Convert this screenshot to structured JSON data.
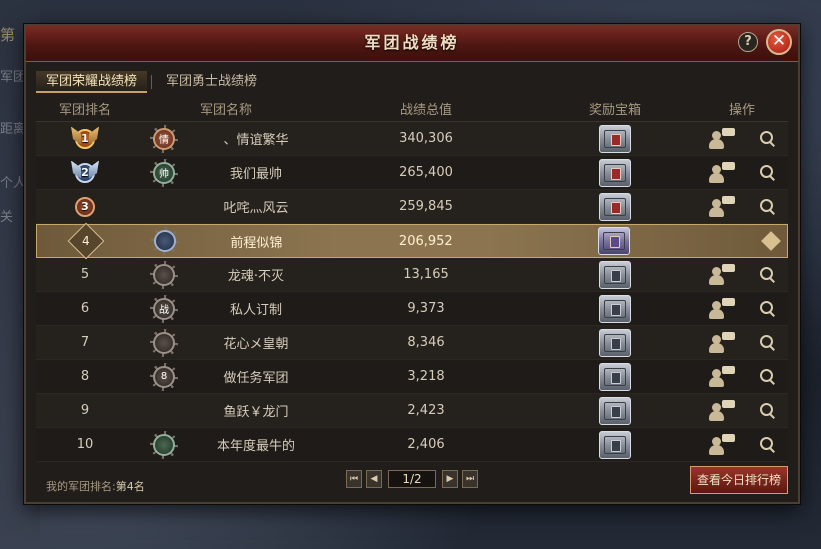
{
  "background": {
    "left_texts": [
      "第",
      "军团",
      "距离",
      "个人",
      "关"
    ]
  },
  "dialog": {
    "title": "军团战绩榜",
    "help_label": "?",
    "close_label": "✕"
  },
  "tabs": [
    {
      "label": "军团荣耀战绩榜",
      "active": true
    },
    {
      "label": "军团勇士战绩榜",
      "active": false
    }
  ],
  "columns": {
    "rank": "军团排名",
    "name": "军团名称",
    "score": "战绩总值",
    "chest": "奖励宝箱",
    "action": "操作"
  },
  "rows": [
    {
      "rank": "1",
      "emblem": "情",
      "name": "、情谊繁华",
      "score": "340,306",
      "medal": "gold",
      "emblem_color": "red",
      "chest": "red"
    },
    {
      "rank": "2",
      "emblem": "帅",
      "name": "我们最帅",
      "score": "265,400",
      "medal": "silver",
      "emblem_color": "green",
      "chest": "red"
    },
    {
      "rank": "3",
      "emblem": "",
      "name": "叱咤灬风云",
      "score": "259,845",
      "medal": "bronze",
      "emblem_color": "empty",
      "chest": "red"
    },
    {
      "rank": "4",
      "emblem": "",
      "name": "前程似锦",
      "score": "206,952",
      "medal": "self",
      "emblem_color": "blue",
      "chest": "purple"
    },
    {
      "rank": "5",
      "emblem": "",
      "name": "龙魂·不灭",
      "score": "13,165",
      "medal": "plain",
      "emblem_color": "plain",
      "chest": "silver"
    },
    {
      "rank": "6",
      "emblem": "战",
      "name": "私人订制",
      "score": "9,373",
      "medal": "plain",
      "emblem_color": "plain",
      "chest": "silver"
    },
    {
      "rank": "7",
      "emblem": "",
      "name": "花心メ皇朝",
      "score": "8,346",
      "medal": "plain",
      "emblem_color": "plain",
      "chest": "silver"
    },
    {
      "rank": "8",
      "emblem": "8",
      "name": "做任务军团",
      "score": "3,218",
      "medal": "plain",
      "emblem_color": "plain",
      "chest": "silver"
    },
    {
      "rank": "9",
      "emblem": "",
      "name": "鱼跃￥龙门",
      "score": "2,423",
      "medal": "plain",
      "emblem_color": "empty",
      "chest": "silver"
    },
    {
      "rank": "10",
      "emblem": "",
      "name": "本年度最牛的",
      "score": "2,406",
      "medal": "plain",
      "emblem_color": "green",
      "chest": "silver"
    }
  ],
  "footer": {
    "my_rank_label": "我的军团排名:",
    "my_rank_value": "第4名",
    "page": "1/2",
    "first_label": "⏮",
    "prev_label": "◀",
    "next_label": "▶",
    "last_label": "⏭",
    "today_button": "查看今日排行榜"
  }
}
